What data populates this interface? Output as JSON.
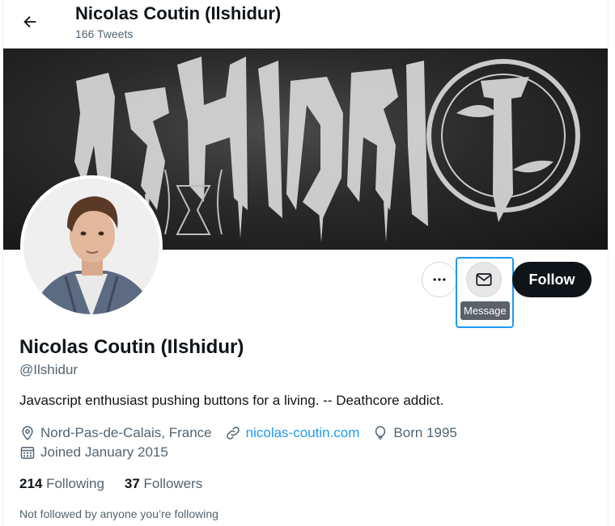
{
  "header": {
    "title": "Nicolas Coutin (Ilshidur)",
    "subtitle": "166 Tweets",
    "back_icon": "arrow-left-icon"
  },
  "banner": {
    "image": "band-logo-banner"
  },
  "avatar": {
    "image": "profile-photo"
  },
  "actions": {
    "more_icon": "more-horizontal-icon",
    "message_icon": "envelope-icon",
    "message_tooltip": "Message",
    "follow_label": "Follow"
  },
  "profile": {
    "name": "Nicolas Coutin (Ilshidur)",
    "handle": "@Ilshidur",
    "bio": "Javascript enthusiast pushing buttons for a living. -- Deathcore addict.",
    "location": "Nord-Pas-de-Calais, France",
    "website": "nicolas-coutin.com",
    "birthday": "Born 1995",
    "joined": "Joined January 2015"
  },
  "stats": {
    "following_count": "214",
    "following_label": "Following",
    "followers_count": "37",
    "followers_label": "Followers"
  },
  "mutual_note": "Not followed by anyone you’re following",
  "colors": {
    "accent": "#1d9bf0",
    "text": "#0f1419",
    "secondary": "#536471",
    "follow_bg": "#0f1419"
  }
}
